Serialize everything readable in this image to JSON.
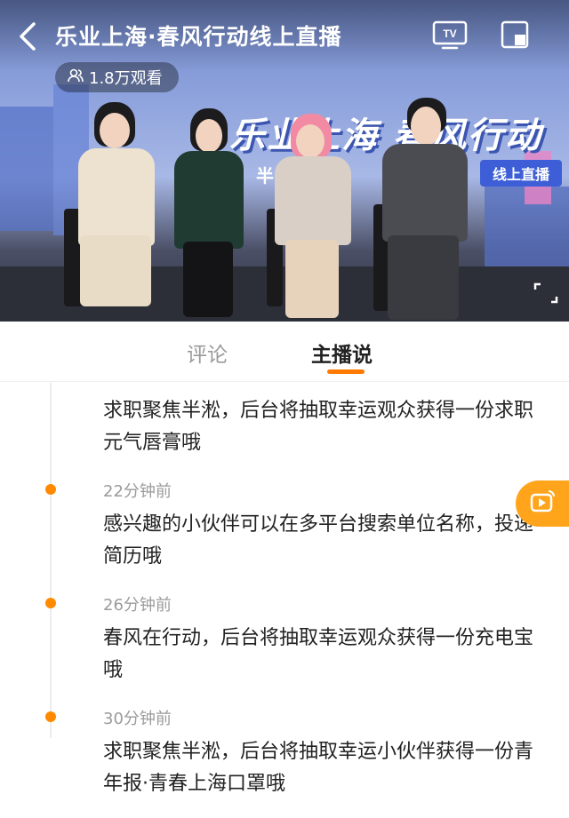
{
  "header": {
    "title": "乐业上海·春风行动线上直播",
    "viewers": "1.8万观看"
  },
  "video": {
    "backdrop_title": "乐业上海 春风行动",
    "backdrop_sub": "半 街道",
    "live_badge": "线上直播"
  },
  "tabs": [
    {
      "label": "评论",
      "active": false
    },
    {
      "label": "主播说",
      "active": true
    }
  ],
  "feed": {
    "entries": [
      {
        "time": "",
        "text": "求职聚焦半淞，后台将抽取幸运观众获得一份求职元气唇膏哦"
      },
      {
        "time": "22分钟前",
        "text": "感兴趣的小伙伴可以在多平台搜索单位名称，投递简历哦"
      },
      {
        "time": "26分钟前",
        "text": "春风在行动，后台将抽取幸运观众获得一份充电宝哦"
      },
      {
        "time": "30分钟前",
        "text": "求职聚焦半淞，后台将抽取幸运小伙伴获得一份青年报·青春上海口罩哦"
      }
    ]
  },
  "colors": {
    "accent": "#ff7a00",
    "timeline_dot": "#ff8a00",
    "float_button": "#ffa41b"
  },
  "icons": [
    "back-icon",
    "tv-icon",
    "pip-icon",
    "viewers-icon",
    "fullscreen-icon",
    "live-replay-icon"
  ]
}
